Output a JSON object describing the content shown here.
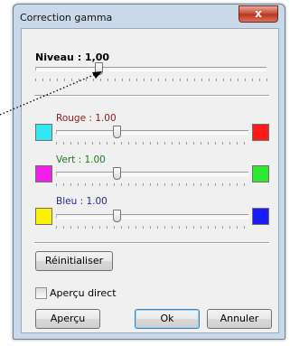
{
  "window": {
    "title": "Correction gamma",
    "close_label": "x"
  },
  "level": {
    "label": "Niveau : 1,00",
    "value": 1.0
  },
  "channels": [
    {
      "label": "Rouge : 1.00",
      "label_color": "#8b1a1a",
      "value": 1.0,
      "left_color": "#33e8f0",
      "right_color": "#ff1a1a"
    },
    {
      "label": "Vert : 1.00",
      "label_color": "#1f7a1f",
      "value": 1.0,
      "left_color": "#f01ee6",
      "right_color": "#2ee82e"
    },
    {
      "label": "Bleu : 1.00",
      "label_color": "#1f2e8b",
      "value": 1.0,
      "left_color": "#fff200",
      "right_color": "#1a1aff"
    }
  ],
  "buttons": {
    "reset": "Réinitialiser",
    "preview": "Aperçu",
    "ok": "Ok",
    "cancel": "Annuler"
  },
  "direct_preview": {
    "label": "Aperçu direct",
    "checked": false
  }
}
